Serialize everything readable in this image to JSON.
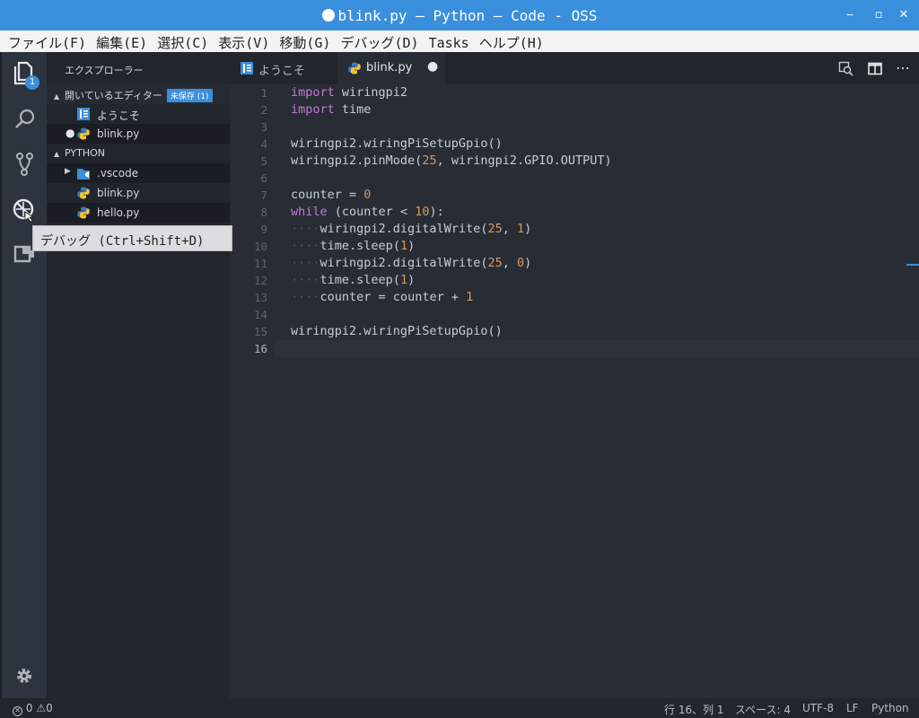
{
  "window": {
    "title": "blink.py — Python — Code - OSS",
    "minimize_glyph": "‒",
    "maximize_glyph": "▫",
    "close_glyph": "✕"
  },
  "menu": [
    "ファイル(F)",
    "編集(E)",
    "選択(C)",
    "表示(V)",
    "移動(G)",
    "デバッグ(D)",
    "Tasks",
    "ヘルプ(H)"
  ],
  "activity": {
    "explorer_badge": "1"
  },
  "tooltip": "デバッグ (Ctrl+Shift+D)",
  "sidebar": {
    "title": "エクスプローラー",
    "open_editors": {
      "label": "開いているエディター",
      "badge": "未保存 (1)",
      "items": [
        "ようこそ",
        "blink.py"
      ]
    },
    "folder": {
      "label": "PYTHON",
      "items": [
        ".vscode",
        "blink.py",
        "hello.py"
      ]
    }
  },
  "tabs": [
    {
      "label": "ようこそ"
    },
    {
      "label": "blink.py"
    }
  ],
  "editor": {
    "line_numbers": [
      "1",
      "2",
      "3",
      "4",
      "5",
      "6",
      "7",
      "8",
      "9",
      "10",
      "11",
      "12",
      "13",
      "14",
      "15",
      "16"
    ]
  },
  "status": {
    "errors": "0",
    "warnings": "0",
    "position": "行 16、列 1",
    "spaces": "スペース: 4",
    "encoding": "UTF-8",
    "eol": "LF",
    "language": "Python"
  },
  "colors": {
    "accent": "#3a8fdc",
    "keyword": "#c678dd",
    "number": "#d19a66"
  }
}
